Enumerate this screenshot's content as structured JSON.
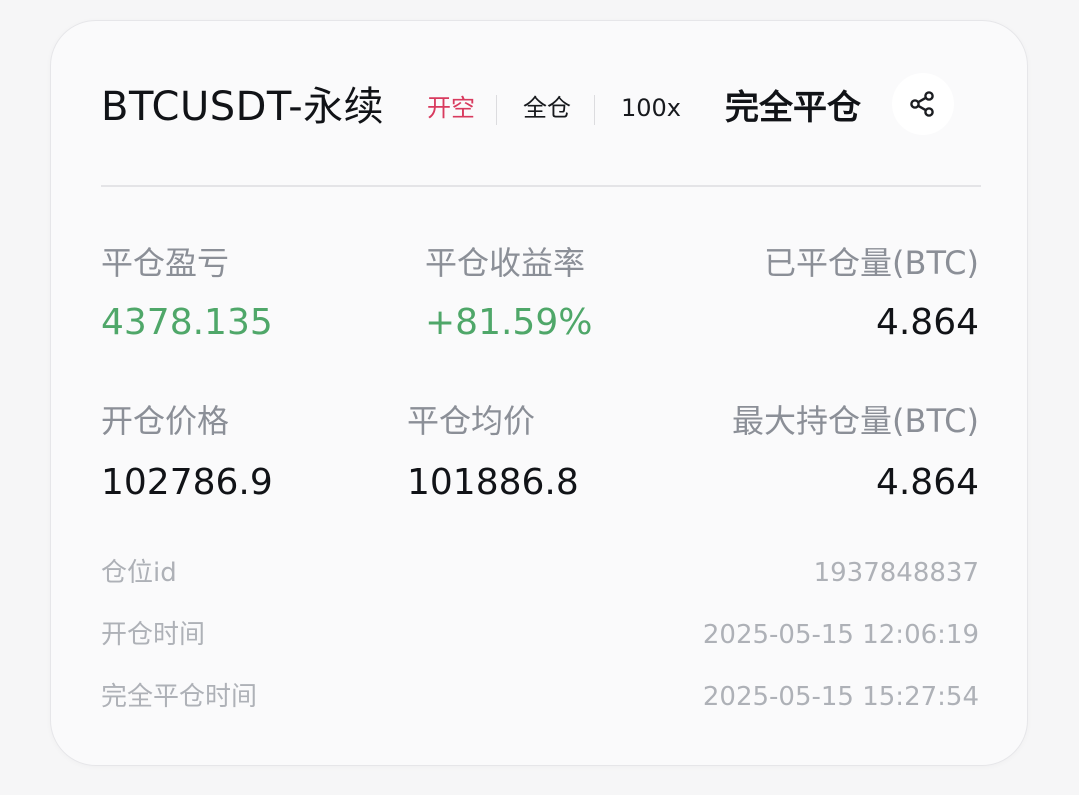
{
  "header": {
    "symbol": "BTCUSDT-永续",
    "side": "开空",
    "margin_mode": "全仓",
    "leverage": "100x",
    "close_status": "完全平仓",
    "share_icon": "share-icon"
  },
  "stats": {
    "realized_pnl": {
      "label": "平仓盈亏",
      "value": "4378.135"
    },
    "close_roi": {
      "label": "平仓收益率",
      "value": "+81.59%"
    },
    "closed_qty": {
      "label": "已平仓量(BTC)",
      "value": "4.864"
    },
    "entry_price": {
      "label": "开仓价格",
      "value": "102786.9"
    },
    "avg_close_price": {
      "label": "平仓均价",
      "value": "101886.8"
    },
    "max_position": {
      "label": "最大持仓量(BTC)",
      "value": "4.864"
    }
  },
  "details": {
    "position_id": {
      "label": "仓位id",
      "value": "1937848837"
    },
    "open_time": {
      "label": "开仓时间",
      "value": "2025-05-15 12:06:19"
    },
    "close_time": {
      "label": "完全平仓时间",
      "value": "2025-05-15 15:27:54"
    }
  },
  "colors": {
    "profit_green": "#4fa769",
    "short_red": "#d83a5e",
    "label_gray": "#8b8f97",
    "detail_gray": "#aeb1b7",
    "text_dark": "#111317"
  }
}
